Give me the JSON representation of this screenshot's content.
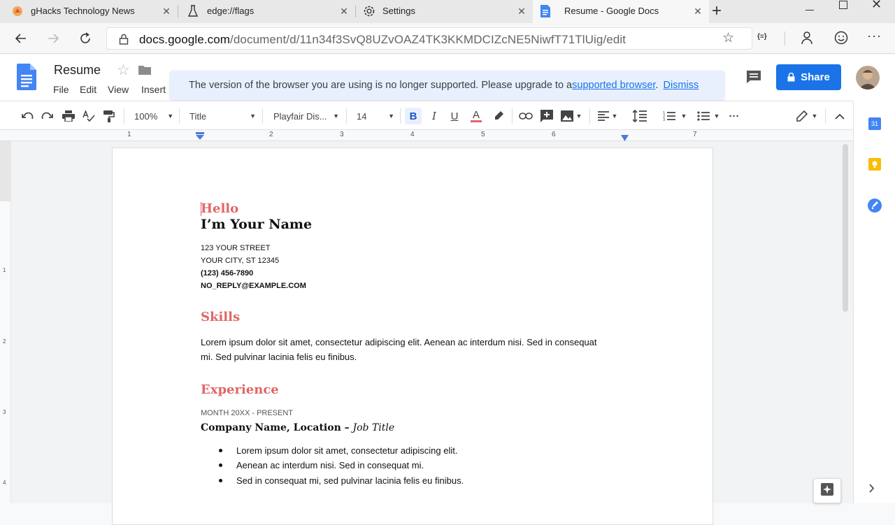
{
  "browser": {
    "tabs": [
      {
        "title": "gHacks Technology News",
        "icon": "ghacks-icon"
      },
      {
        "title": "edge://flags",
        "icon": "flask-icon"
      },
      {
        "title": "Settings",
        "icon": "gear-icon"
      },
      {
        "title": "Resume - Google Docs",
        "icon": "docs-icon",
        "active": true
      }
    ],
    "new_tab": "+",
    "url_host": "docs.google.com",
    "url_path": "/document/d/11n34f3SvQ8UZvOAZ4TK3KKMDCIZcNE5NiwfT71TlUig/edit",
    "extension_label": "{≡}"
  },
  "docs": {
    "title": "Resume",
    "menu": [
      "File",
      "Edit",
      "View",
      "Insert"
    ],
    "banner": {
      "text": "The version of the browser you are using is no longer supported. Please upgrade to a",
      "link": "supported browser",
      "after": ".",
      "dismiss": "Dismiss"
    },
    "share_label": "Share",
    "toolbar": {
      "zoom": "100%",
      "style": "Title",
      "font": "Playfair Dis...",
      "size": "14",
      "bold": "B",
      "italic": "I",
      "underline": "U",
      "text_color": "A",
      "more": "···"
    },
    "ruler_numbers": [
      "1",
      "1",
      "2",
      "3",
      "4",
      "5",
      "6",
      "7"
    ],
    "vruler_numbers": [
      "1",
      "2",
      "3",
      "4"
    ]
  },
  "content": {
    "hello": "Hello",
    "name": "I’m Your Name",
    "address1": "123 YOUR STREET",
    "address2": "YOUR CITY, ST 12345",
    "phone": "(123) 456-7890",
    "email": "NO_REPLY@EXAMPLE.COM",
    "skills_heading": "Skills",
    "skills_line1": "Lorem ipsum dolor sit amet, consectetur adipiscing elit. Aenean ac interdum nisi. Sed in consequat",
    "skills_line2": "mi. Sed pulvinar lacinia felis eu finibus.",
    "experience_heading": "Experience",
    "date_range": "MONTH 20XX - PRESENT",
    "company": "Company Name, Location – ",
    "job_title": "Job Title",
    "bullets": [
      "Lorem ipsum dolor sit amet, consectetur adipiscing elit.",
      "Aenean ac interdum nisi. Sed in consequat mi.",
      "Sed in consequat mi, sed pulvinar lacinia felis eu finibus."
    ]
  },
  "colors": {
    "accent_red": "#e06666",
    "share_blue": "#1a73e8",
    "banner_bg": "#e8f0fe"
  },
  "sidepanel": {
    "calendar_day": "31"
  }
}
